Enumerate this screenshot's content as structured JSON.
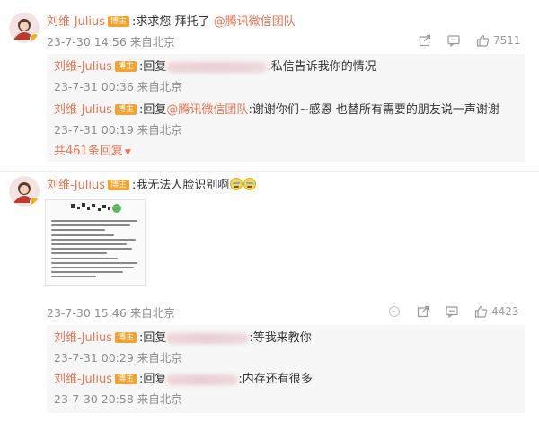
{
  "colors": {
    "accent": "#eb7350",
    "badge": "#f2a22f",
    "meta": "#8c8c8c",
    "reply_bg": "#f7f7f7"
  },
  "comments": [
    {
      "username": "刘维-Julius",
      "badge": "博主",
      "text": ":求求您 拜托了 ",
      "mention": "@腾讯微信团队",
      "time": "23-7-30 14:56 来自北京",
      "likes": "7511",
      "replies": [
        {
          "username": "刘维-Julius",
          "badge": "博主",
          "prefix": ":回复",
          "text": ":私信告诉我你的情况",
          "time": "23-7-31 00:36 来自北京"
        },
        {
          "username": "刘维-Julius",
          "badge": "博主",
          "prefix": ":回复",
          "mention": "@腾讯微信团队",
          "text": ":谢谢你们~感恩 也替所有需要的朋友说一声谢谢",
          "time": "23-7-31 00:19 来自北京"
        }
      ],
      "more_replies": "共461条回复"
    },
    {
      "username": "刘维-Julius",
      "badge": "博主",
      "text": ":我无法人脸识别啊",
      "time": "23-7-30 15:46 来自北京",
      "likes": "4423",
      "replies": [
        {
          "username": "刘维-Julius",
          "badge": "博主",
          "prefix": ":回复",
          "text": ":等我来教你",
          "time": "23-7-31 00:29 来自北京"
        },
        {
          "username": "刘维-Julius",
          "badge": "博主",
          "prefix": ":回复",
          "text": ":内存还有很多",
          "time": "23-7-30 20:58 来自北京"
        }
      ]
    }
  ],
  "icons": [
    "share-icon",
    "comment-icon",
    "like-icon",
    "more-icon",
    "verified-badge-icon"
  ]
}
